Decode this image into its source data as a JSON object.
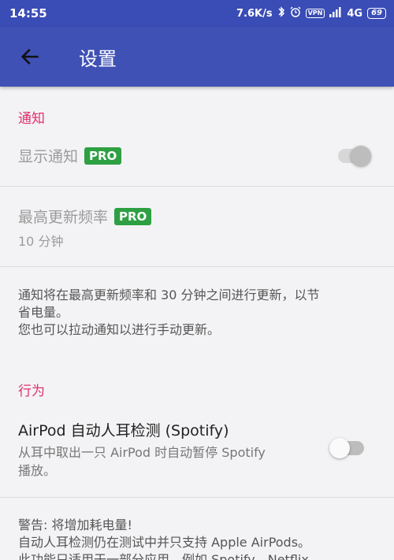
{
  "status_bar": {
    "time": "14:55",
    "speed": "7.6K/s",
    "vpn": "VPN",
    "network": "4G",
    "battery": "69"
  },
  "app_bar": {
    "title": "设置"
  },
  "notifications_section": {
    "header": "通知",
    "show_notification": {
      "label": "显示通知",
      "badge": "PRO",
      "enabled": false
    },
    "max_frequency": {
      "label": "最高更新频率",
      "badge": "PRO",
      "value": "10 分钟"
    },
    "description_line1": "通知将在最高更新频率和 30 分钟之间进行更新，以节",
    "description_line2": "省电量。",
    "description_line3": "您也可以拉动通知以进行手动更新。"
  },
  "behavior_section": {
    "header": "行为",
    "ear_detection": {
      "label": "AirPod 自动人耳检测 (Spotify)",
      "sub_line1": "从耳中取出一只 AirPod 时自动暂停 Spotify",
      "sub_line2": "播放。",
      "enabled": false
    },
    "warning_line1": "警告: 将增加耗电量!",
    "warning_line2": "自动人耳检测仍在测试中并只支持 Apple AirPods。",
    "warning_line3": "此功能只适用于一部分应用，例如 Spotify、Netflix"
  },
  "colors": {
    "app_bar": "#3f51b5",
    "status_bar": "#3a4cb5",
    "section_header": "#e0306b",
    "pro_badge": "#2ea043"
  }
}
